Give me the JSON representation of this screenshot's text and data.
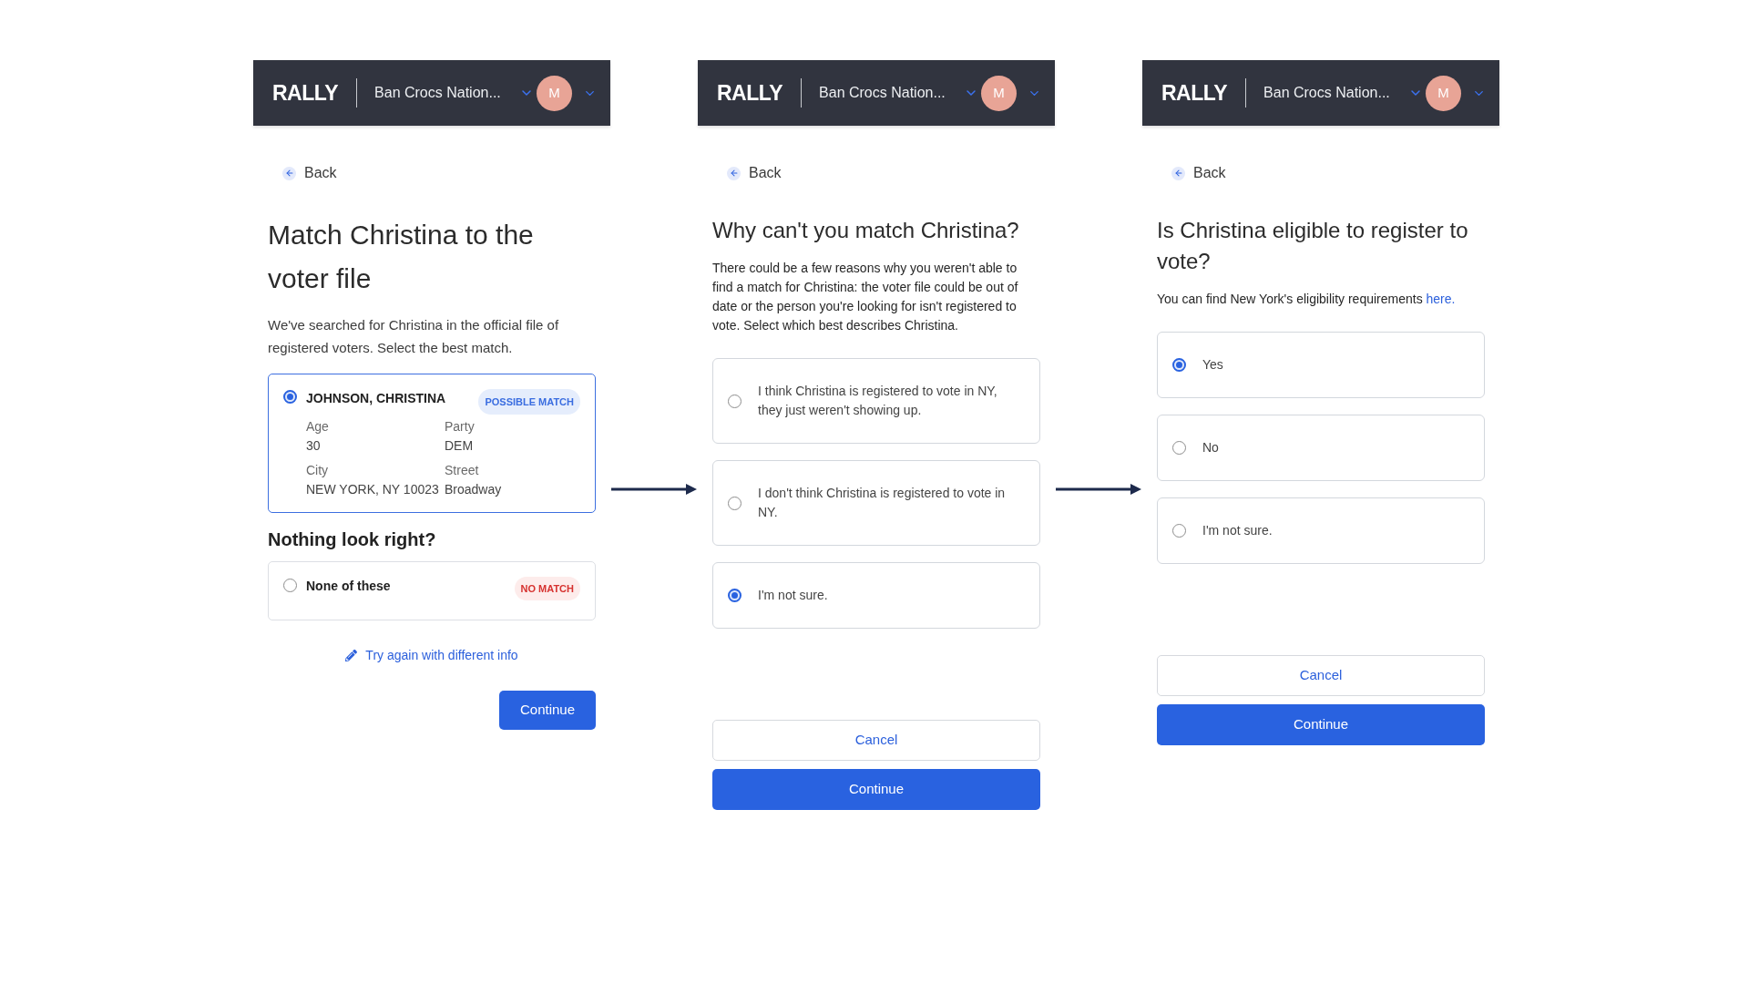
{
  "screens": [
    {
      "kind": "match",
      "header": {
        "logo": "RALLY",
        "organization": "Ban Crocs Nation...",
        "avatar": "M"
      },
      "back": "Back",
      "title": "Match Christina to the voter file",
      "description": {
        "text": "We've searched for Christina in the official file of registered voters. Select the best match."
      },
      "matches": [
        {
          "name": "JOHNSON, CHRISTINA",
          "badge": "POSSIBLE MATCH",
          "selected": true,
          "fields": [
            {
              "label": "Age",
              "value": "30"
            },
            {
              "label": "Party",
              "value": "DEM"
            },
            {
              "label": "City",
              "value": "NEW YORK, NY 10023"
            },
            {
              "label": "Street",
              "value": "Broadway"
            }
          ]
        }
      ],
      "no_match": {
        "heading": "Nothing look right?",
        "option": {
          "label": "None of these",
          "badge": "NO MATCH",
          "selected": false
        }
      },
      "retry_link": "Try again with different info",
      "buttons": [
        {
          "label": "Continue",
          "kind": "primary"
        }
      ]
    },
    {
      "kind": "question",
      "header": {
        "logo": "RALLY",
        "organization": "Ban Crocs Nation...",
        "avatar": "M"
      },
      "back": "Back",
      "title": "Why can't you match Christina?",
      "description": {
        "text": "There could be a few reasons why you weren't able to find a match for Christina: the voter file could be out of date or the person you're looking for isn't registered to vote. Select which best describes Christina."
      },
      "options": [
        {
          "label": "I think Christina is registered to vote in NY, they just weren't showing up.",
          "selected": false
        },
        {
          "label": "I don't think Christina is registered to vote in NY.",
          "selected": false
        },
        {
          "label": "I'm not sure.",
          "selected": true
        }
      ],
      "buttons": [
        {
          "label": "Cancel",
          "kind": "secondary"
        },
        {
          "label": "Continue",
          "kind": "primary"
        }
      ]
    },
    {
      "kind": "question",
      "header": {
        "logo": "RALLY",
        "organization": "Ban Crocs Nation...",
        "avatar": "M"
      },
      "back": "Back",
      "title": "Is Christina eligible to register to vote?",
      "description": {
        "text": "You can find New York's eligibility requirements",
        "link": "here."
      },
      "options": [
        {
          "label": "Yes",
          "selected": true
        },
        {
          "label": "No",
          "selected": false
        },
        {
          "label": "I'm not sure.",
          "selected": false
        }
      ],
      "buttons": [
        {
          "label": "Cancel",
          "kind": "secondary"
        },
        {
          "label": "Continue",
          "kind": "primary"
        }
      ]
    }
  ]
}
